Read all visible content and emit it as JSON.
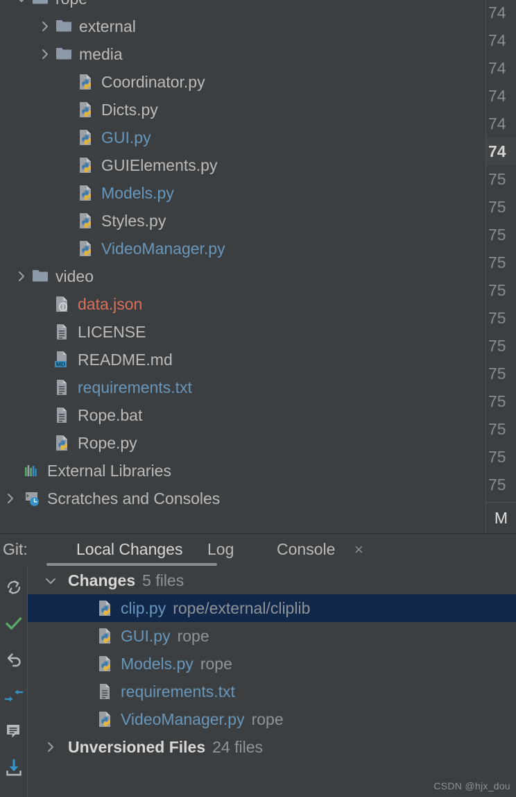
{
  "project_tree": {
    "rows": [
      {
        "indent": 44,
        "arrow": "chevron-down",
        "icon": "folder",
        "label": "rope",
        "color": "default"
      },
      {
        "indent": 78,
        "arrow": "chevron-right",
        "icon": "folder",
        "label": "external",
        "color": "default"
      },
      {
        "indent": 78,
        "arrow": "chevron-right",
        "icon": "folder",
        "label": "media",
        "color": "default"
      },
      {
        "indent": 110,
        "arrow": "none",
        "icon": "python-file",
        "label": "Coordinator.py",
        "color": "default"
      },
      {
        "indent": 110,
        "arrow": "none",
        "icon": "python-file",
        "label": "Dicts.py",
        "color": "default"
      },
      {
        "indent": 110,
        "arrow": "none",
        "icon": "python-file",
        "label": "GUI.py",
        "color": "blue"
      },
      {
        "indent": 110,
        "arrow": "none",
        "icon": "python-file",
        "label": "GUIElements.py",
        "color": "default"
      },
      {
        "indent": 110,
        "arrow": "none",
        "icon": "python-file",
        "label": "Models.py",
        "color": "blue"
      },
      {
        "indent": 110,
        "arrow": "none",
        "icon": "python-file",
        "label": "Styles.py",
        "color": "default"
      },
      {
        "indent": 110,
        "arrow": "none",
        "icon": "python-file",
        "label": "VideoManager.py",
        "color": "blue"
      },
      {
        "indent": 44,
        "arrow": "chevron-right",
        "icon": "folder",
        "label": "video",
        "color": "default"
      },
      {
        "indent": 76,
        "arrow": "none",
        "icon": "json-file",
        "label": "data.json",
        "color": "red"
      },
      {
        "indent": 76,
        "arrow": "none",
        "icon": "text-file",
        "label": "LICENSE",
        "color": "default"
      },
      {
        "indent": 76,
        "arrow": "none",
        "icon": "markdown-file",
        "label": "README.md",
        "color": "default"
      },
      {
        "indent": 76,
        "arrow": "none",
        "icon": "text-file",
        "label": "requirements.txt",
        "color": "blue"
      },
      {
        "indent": 76,
        "arrow": "none",
        "icon": "text-file",
        "label": "Rope.bat",
        "color": "default"
      },
      {
        "indent": 76,
        "arrow": "none",
        "icon": "python-file",
        "label": "Rope.py",
        "color": "default"
      },
      {
        "indent": 32,
        "arrow": "none",
        "icon": "external-libraries",
        "label": "External Libraries",
        "color": "default"
      },
      {
        "indent": 32,
        "arrow": "chevron-right-edge",
        "icon": "scratches",
        "label": "Scratches and Consoles",
        "color": "default"
      }
    ]
  },
  "editor_gutter": {
    "line_numbers": [
      "74",
      "74",
      "74",
      "74",
      "74",
      "74",
      "75",
      "75",
      "75",
      "75",
      "75",
      "75",
      "75",
      "75",
      "75",
      "75",
      "75",
      "75"
    ],
    "current_line_index": 5,
    "bottom_marker": "M"
  },
  "git_panel": {
    "window_label": "Git:",
    "tabs": [
      {
        "label": "Local Changes",
        "active": true,
        "closable": false
      },
      {
        "label": "Log",
        "active": false,
        "closable": false
      },
      {
        "label": "Console",
        "active": false,
        "closable": true
      }
    ],
    "close_glyph": "×",
    "toolbar_buttons": [
      {
        "name": "refresh-button",
        "icon": "refresh-icon"
      },
      {
        "name": "commit-button",
        "icon": "checkmark-icon"
      },
      {
        "name": "rollback-button",
        "icon": "undo-arrow-icon"
      },
      {
        "name": "show-diff-button",
        "icon": "diff-arrows-icon"
      },
      {
        "name": "shelve-button",
        "icon": "shelf-note-icon"
      },
      {
        "name": "update-project-button",
        "icon": "download-arrow-icon"
      }
    ],
    "rows": [
      {
        "type": "group",
        "indent": 24,
        "arrow": "chevron-down",
        "label": "Changes",
        "count": "5 files",
        "selected": false
      },
      {
        "type": "file",
        "indent": 98,
        "icon": "python-file",
        "name": "clip.py",
        "path": "rope/external/cliplib",
        "selected": true
      },
      {
        "type": "file",
        "indent": 98,
        "icon": "python-file",
        "name": "GUI.py",
        "path": "rope",
        "selected": false
      },
      {
        "type": "file",
        "indent": 98,
        "icon": "python-file",
        "name": "Models.py",
        "path": "rope",
        "selected": false
      },
      {
        "type": "file",
        "indent": 98,
        "icon": "text-file",
        "name": "requirements.txt",
        "path": "",
        "selected": false
      },
      {
        "type": "file",
        "indent": 98,
        "icon": "python-file",
        "name": "VideoManager.py",
        "path": "rope",
        "selected": false
      },
      {
        "type": "group",
        "indent": 24,
        "arrow": "chevron-right",
        "label": "Unversioned Files",
        "count": "24 files",
        "selected": false
      }
    ]
  },
  "watermark": {
    "text": "CSDN @hjx_dou"
  },
  "colors": {
    "background": "#3c3f41",
    "text_default": "#bbbbbb",
    "text_blue": "#6897bb",
    "text_red": "#d9705a",
    "selection": "#12284a",
    "accent_blue": "#3592c4",
    "accent_green": "#59a869"
  }
}
